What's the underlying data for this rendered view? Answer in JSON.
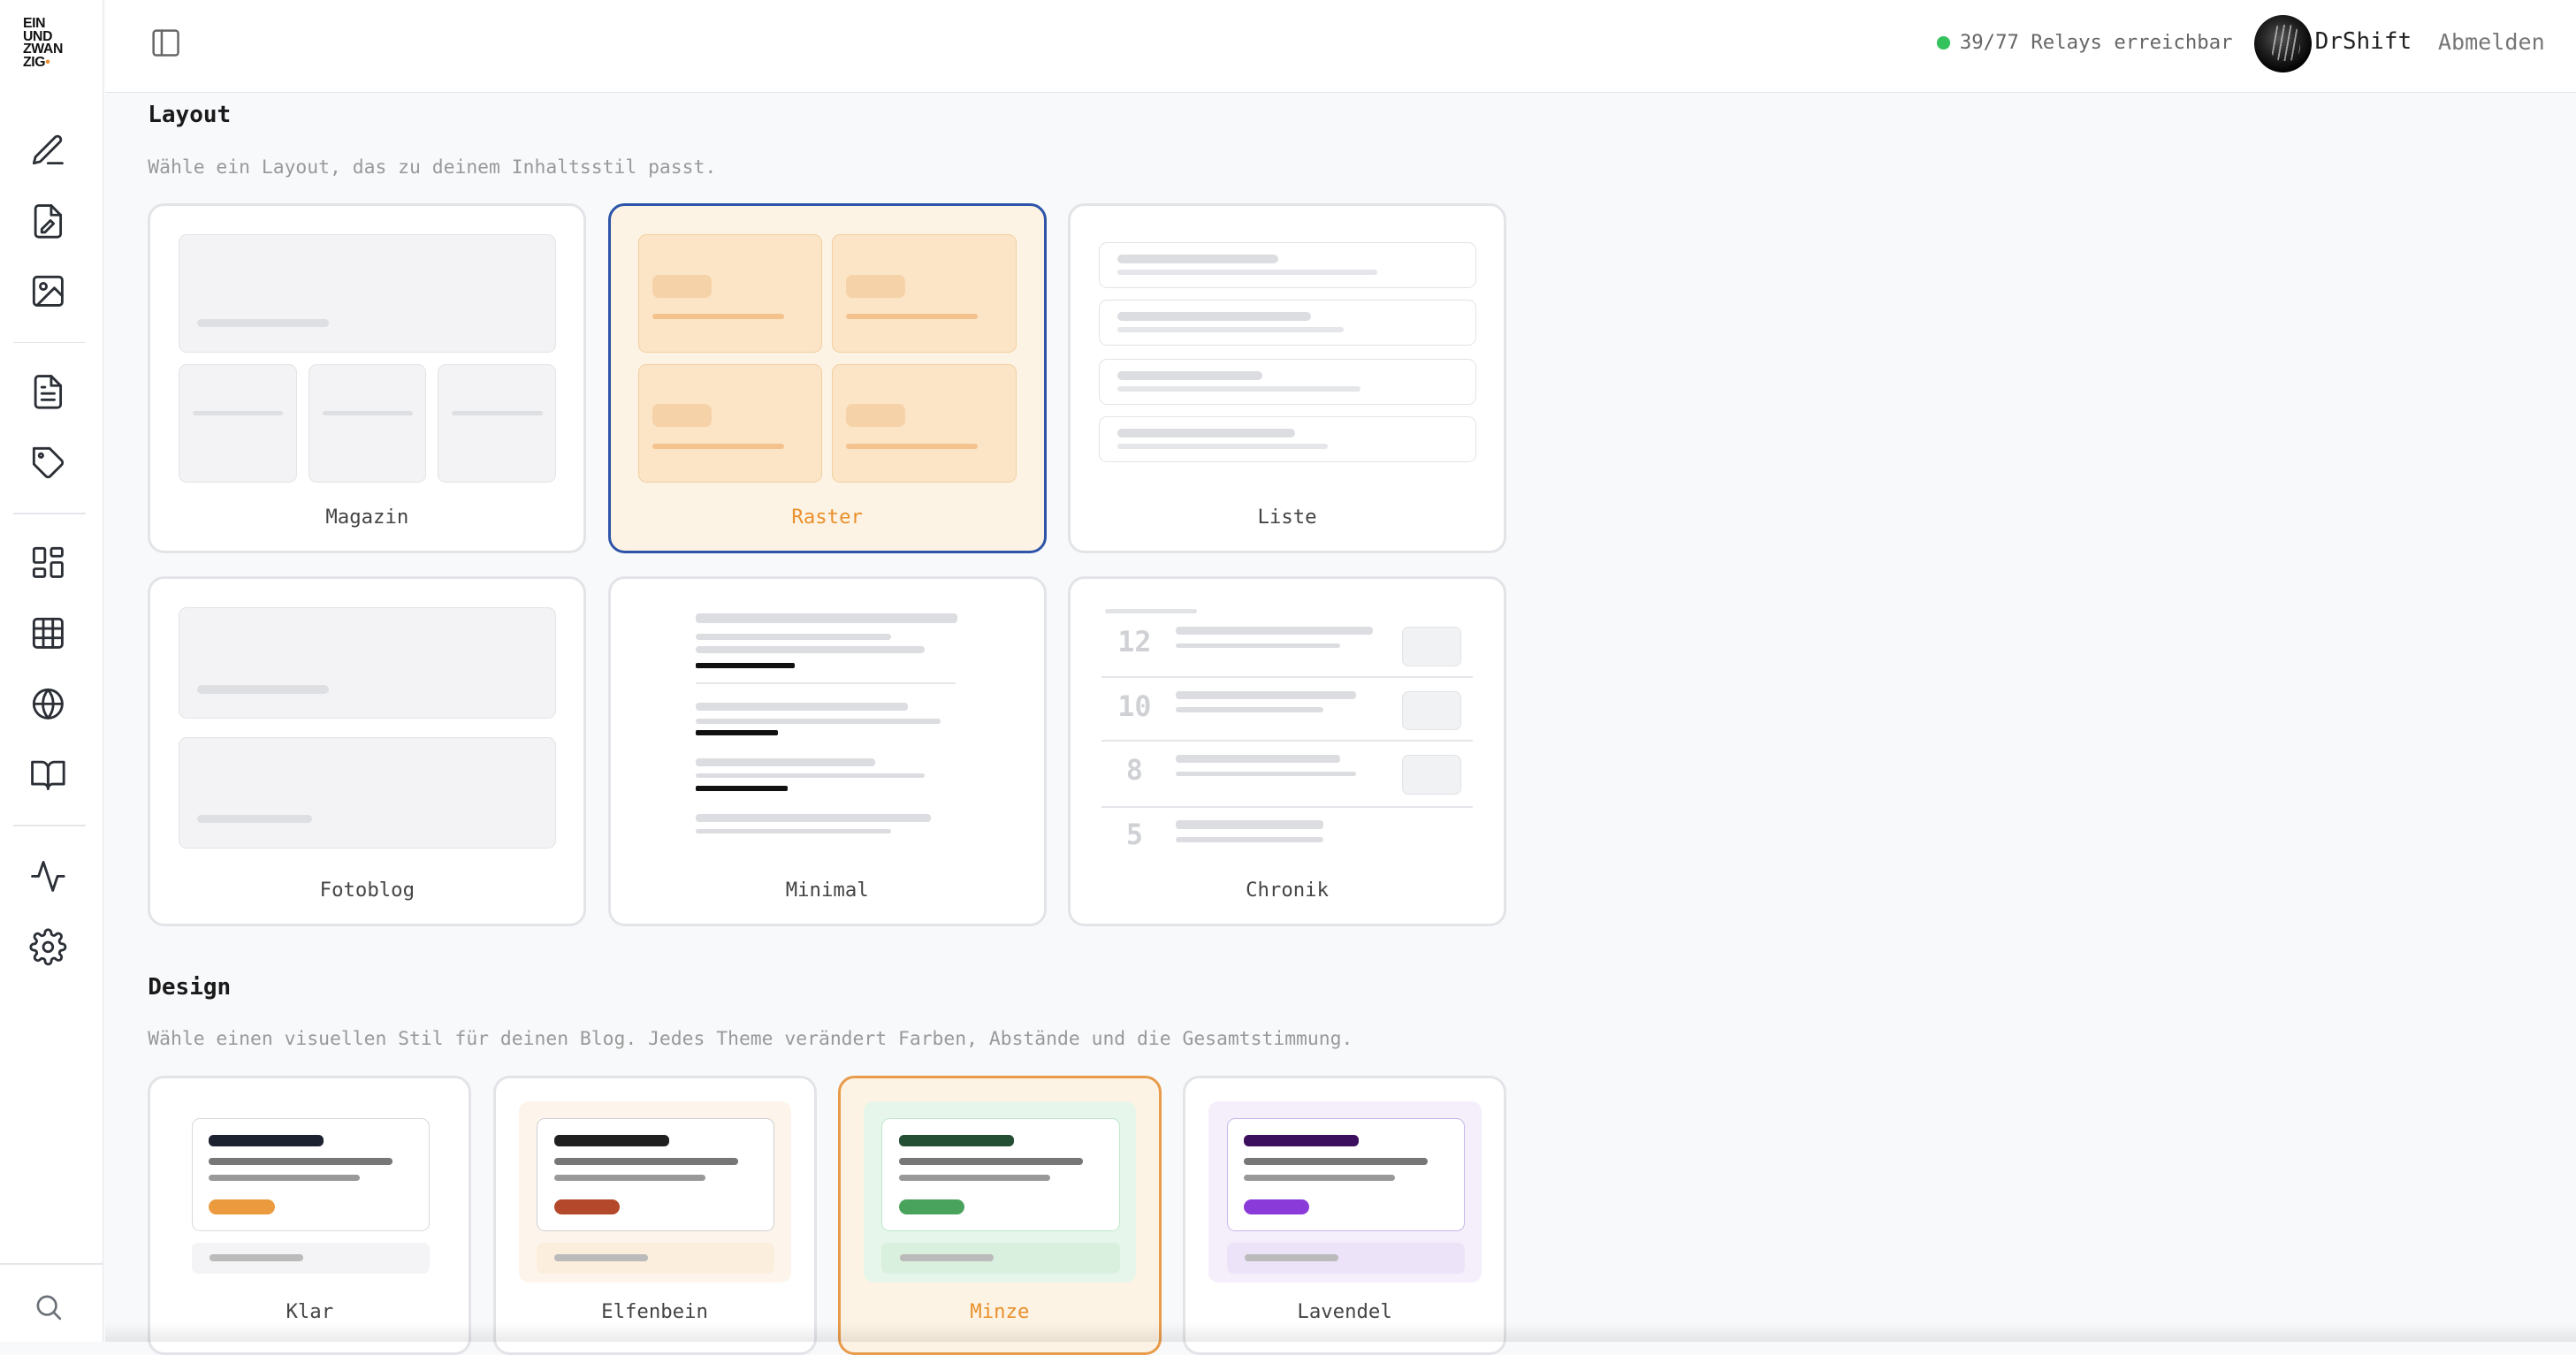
{
  "sidebar": {
    "logo_lines": [
      "EIN",
      "UND",
      "ZWAN",
      "ZIG"
    ],
    "logo_dot": "•",
    "icons": [
      "pencil-icon",
      "file-edit-icon",
      "image-icon",
      "document-icon",
      "tag-icon",
      "dashboard-icon",
      "table-icon",
      "globe-icon",
      "book-icon",
      "activity-icon",
      "settings-icon",
      "search-icon"
    ]
  },
  "header": {
    "relay_status": "39/77 Relays erreichbar",
    "relay_color": "#33c25c",
    "username": "DrShift",
    "logout_label": "Abmelden"
  },
  "layout_section": {
    "title": "Layout",
    "description": "Wähle ein Layout, das zu deinem Inhaltsstil passt.",
    "selected": "Raster",
    "options": [
      {
        "label": "Magazin"
      },
      {
        "label": "Raster"
      },
      {
        "label": "Liste"
      },
      {
        "label": "Fotoblog"
      },
      {
        "label": "Minimal"
      },
      {
        "label": "Chronik",
        "numbers": [
          "12",
          "10",
          "8",
          "5"
        ]
      }
    ]
  },
  "design_section": {
    "title": "Design",
    "description": "Wähle einen visuellen Stil für deinen Blog. Jedes Theme verändert Farben, Abstände und die Gesamtstimmung.",
    "selected": "Minze",
    "themes": [
      {
        "label": "Klar",
        "bg": "#ffffff",
        "border": "#d8d9dd",
        "title": "#1d2230",
        "accent": "#eb9a3d",
        "foot": "#f4f4f6"
      },
      {
        "label": "Elfenbein",
        "bg": "#fdf5ec",
        "border": "#cfcfd3",
        "title": "#1f1f1f",
        "accent": "#b4482a",
        "foot": "#fbeedd"
      },
      {
        "label": "Minze",
        "bg": "#e6f6ea",
        "border": "#bfe8cb",
        "title": "#254f34",
        "accent": "#4aa35c",
        "foot": "#d9f0df"
      },
      {
        "label": "Lavendel",
        "bg": "#f4effb",
        "border": "#c7b6ea",
        "title": "#3b0f5e",
        "accent": "#8a3ad8",
        "foot": "#ece3f8"
      }
    ]
  },
  "colors": {
    "accent": "#e9902c",
    "selected_layout_border": "#2d54a8"
  }
}
